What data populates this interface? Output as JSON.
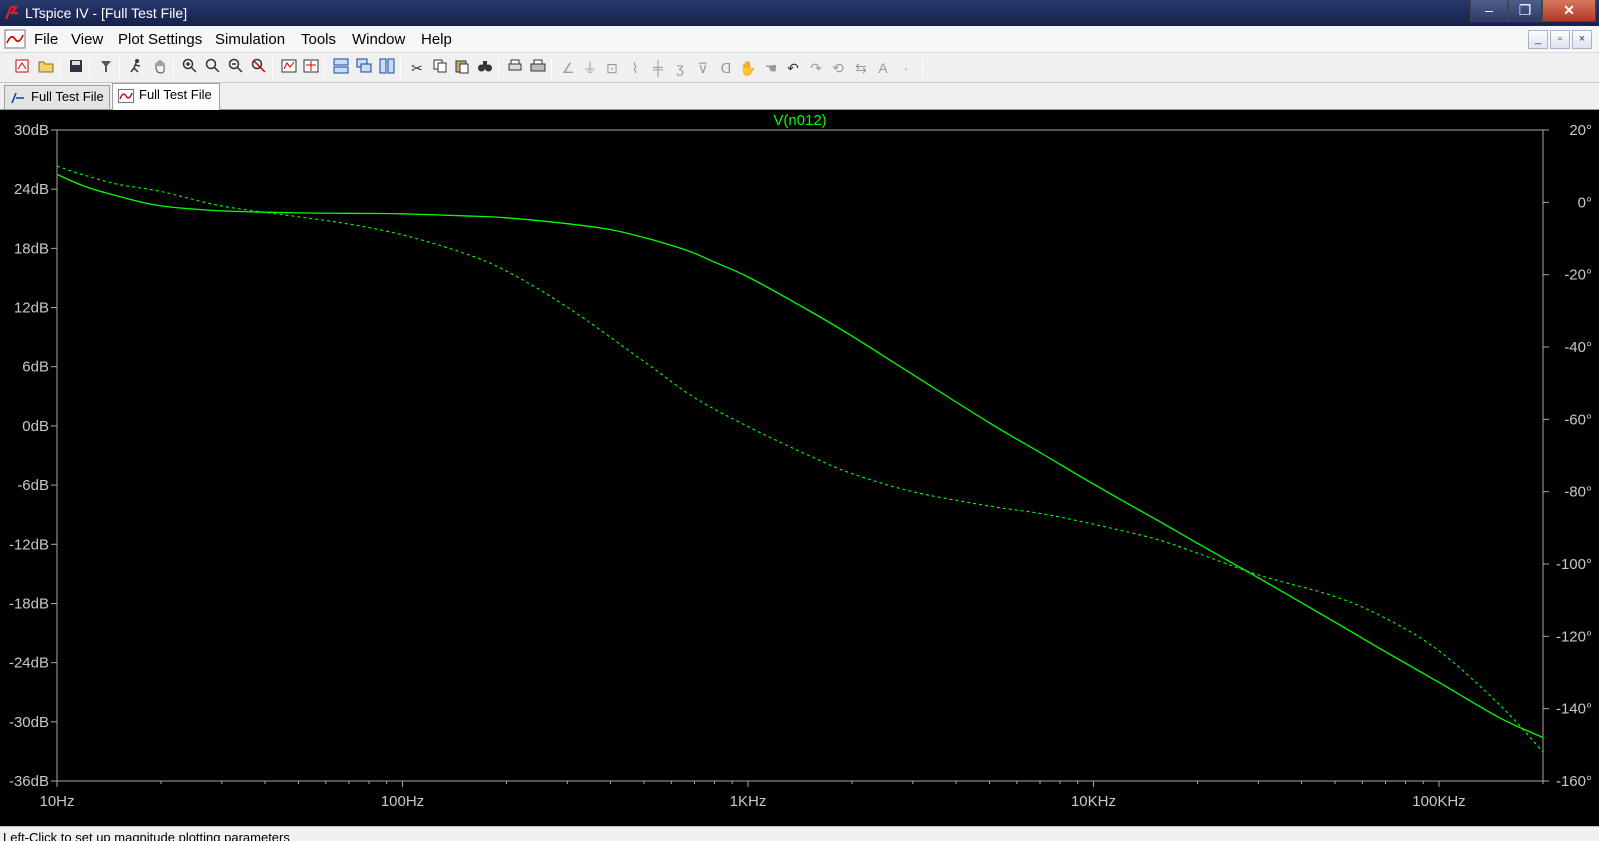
{
  "window": {
    "title": "LTspice IV - [Full Test File]",
    "minimize": "‒",
    "maximize": "❐",
    "close": "✕"
  },
  "menu": {
    "items": [
      "File",
      "View",
      "Plot Settings",
      "Simulation",
      "Tools",
      "Window",
      "Help"
    ],
    "mdi_min": "_",
    "mdi_restore": "▫",
    "mdi_close": "×"
  },
  "toolbar": {
    "icons": [
      "new-schematic-icon",
      "open-icon",
      "save-icon",
      "control-panel-icon",
      "run-icon",
      "pan-icon",
      "zoom-in-icon",
      "zoom-area-icon",
      "zoom-out-icon",
      "zoom-fit-icon",
      "autorange-icon",
      "plot-settings-icon",
      "tile-horizontal-icon",
      "cascade-icon",
      "tile-vertical-icon",
      "cut-icon",
      "copy-icon",
      "paste-icon",
      "find-icon",
      "print-preview-icon",
      "print-icon",
      "wire-icon",
      "ground-icon",
      "label-icon",
      "resistor-icon",
      "capacitor-icon",
      "inductor-icon",
      "diode-icon",
      "component-icon",
      "move-icon",
      "drag-icon",
      "undo-icon",
      "redo-icon",
      "rotate-icon",
      "mirror-icon",
      "text-icon",
      "spice-directive-icon"
    ]
  },
  "tabs": [
    {
      "label": "Full Test File",
      "icon": "schematic-icon",
      "active": false
    },
    {
      "label": "Full Test File",
      "icon": "waveform-icon",
      "active": true
    }
  ],
  "status": {
    "text": "Left-Click to set up magnitude plotting parameters"
  },
  "chart_data": {
    "type": "line",
    "title": "V(n012)",
    "xscale": "log",
    "x_ticks": [
      "10Hz",
      "100Hz",
      "1KHz",
      "10KHz",
      "100KHz"
    ],
    "x_range_hz": [
      10,
      200000
    ],
    "y_left_ticks": [
      "30dB",
      "24dB",
      "18dB",
      "12dB",
      "6dB",
      "0dB",
      "-6dB",
      "-12dB",
      "-18dB",
      "-24dB",
      "-30dB",
      "-36dB"
    ],
    "y_left_range_db": [
      -36,
      30
    ],
    "y_right_ticks": [
      "20°",
      "0°",
      "-20°",
      "-40°",
      "-60°",
      "-80°",
      "-100°",
      "-120°",
      "-140°",
      "-160°"
    ],
    "y_right_range_deg": [
      -160,
      20
    ],
    "grid": false,
    "background": "#000000",
    "trace_color": "#00ff00",
    "series": [
      {
        "name": "magnitude",
        "style": "solid",
        "axis": "left",
        "x_hz": [
          10,
          12,
          15,
          20,
          30,
          50,
          70,
          100,
          150,
          200,
          300,
          400,
          500,
          600,
          700,
          800,
          1000,
          1500,
          2000,
          3000,
          5000,
          7000,
          10000,
          15000,
          20000,
          30000,
          50000,
          70000,
          100000,
          150000,
          200000
        ],
        "y_db": [
          25.5,
          24.3,
          23.3,
          22.3,
          21.8,
          21.6,
          21.55,
          21.5,
          21.3,
          21.1,
          20.5,
          19.9,
          19.1,
          18.3,
          17.5,
          16.6,
          15.1,
          11.7,
          9.1,
          5.2,
          0.3,
          -2.7,
          -5.9,
          -9.4,
          -11.9,
          -15.4,
          -19.9,
          -22.9,
          -26.0,
          -29.6,
          -31.6
        ]
      },
      {
        "name": "phase",
        "style": "dashed",
        "axis": "right",
        "x_hz": [
          10,
          12,
          15,
          20,
          30,
          50,
          70,
          100,
          150,
          200,
          300,
          500,
          700,
          1000,
          1500,
          2000,
          3000,
          5000,
          7000,
          10000,
          15000,
          20000,
          30000,
          50000,
          70000,
          100000,
          150000,
          200000
        ],
        "y_deg": [
          10,
          7.5,
          5,
          3,
          -1,
          -4,
          -6,
          -9,
          -14,
          -19,
          -29,
          -44,
          -54,
          -62,
          -70,
          -75,
          -80,
          -84,
          -86,
          -89,
          -93,
          -97,
          -103,
          -109,
          -115,
          -124,
          -139,
          -152
        ]
      }
    ]
  }
}
